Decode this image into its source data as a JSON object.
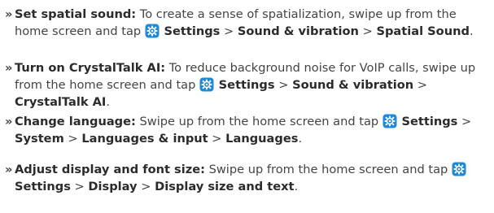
{
  "bullet": "»",
  "icon_color": "#1e88d8",
  "items": [
    {
      "title": "Set spatial sound:",
      "lead": "To create a sense of spatialization, swipe up from the home screen and tap",
      "path": [
        {
          "label": "Settings"
        },
        {
          "sep": ">"
        },
        {
          "label": "Sound & vibration"
        },
        {
          "sep": ">"
        },
        {
          "label": "Spatial Sound"
        }
      ],
      "end": "."
    },
    {
      "title": "Turn on CrystalTalk AI:",
      "lead": "To reduce background noise for VoIP calls, swipe up from the home screen and tap",
      "path": [
        {
          "label": "Settings"
        },
        {
          "sep": ">"
        },
        {
          "label": "Sound & vibration"
        },
        {
          "sep": ">"
        },
        {
          "label": "CrystalTalk AI"
        }
      ],
      "end": "."
    },
    {
      "title": "Change language:",
      "lead": "Swipe up from the home screen and tap",
      "path": [
        {
          "label": "Settings"
        },
        {
          "sep": ">"
        },
        {
          "label": "System"
        },
        {
          "sep": ">"
        },
        {
          "label": "Languages & input"
        },
        {
          "sep": ">"
        },
        {
          "label": "Languages"
        }
      ],
      "end": "."
    },
    {
      "title": "Adjust display and font size:",
      "lead": "Swipe up from the home screen and tap",
      "path": [
        {
          "label": "Settings"
        },
        {
          "sep": ">"
        },
        {
          "label": "Display"
        },
        {
          "sep": ">"
        },
        {
          "label": "Display size and text"
        }
      ],
      "end": "."
    }
  ]
}
